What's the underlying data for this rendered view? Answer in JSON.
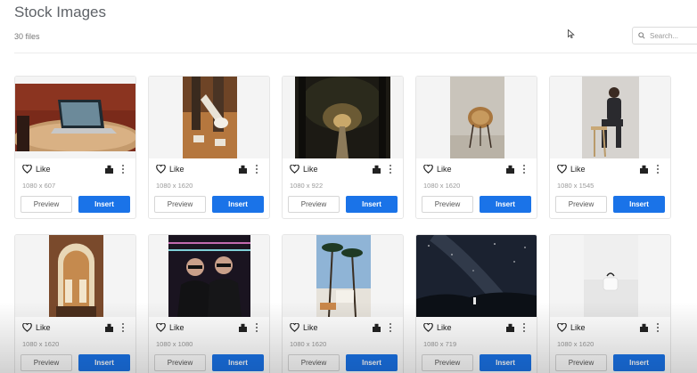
{
  "page": {
    "title": "Stock Images",
    "file_count": "30 files"
  },
  "search": {
    "placeholder": "Search..."
  },
  "colors": {
    "insert_button": "#1a73e8",
    "border": "#e6e6e6"
  },
  "cards": [
    {
      "dims": "1080 x 607",
      "like_label": "Like",
      "preview_label": "Preview",
      "insert_label": "Insert",
      "photo": "laptop on wooden table"
    },
    {
      "dims": "1080 x 1620",
      "like_label": "Like",
      "preview_label": "Preview",
      "insert_label": "Insert",
      "photo": "person with guitar"
    },
    {
      "dims": "1080 x 922",
      "like_label": "Like",
      "preview_label": "Preview",
      "insert_label": "Insert",
      "photo": "forest path"
    },
    {
      "dims": "1080 x 1620",
      "like_label": "Like",
      "preview_label": "Preview",
      "insert_label": "Insert",
      "photo": "rattan chair"
    },
    {
      "dims": "1080 x 1545",
      "like_label": "Like",
      "preview_label": "Preview",
      "insert_label": "Insert",
      "photo": "man sitting on stool"
    },
    {
      "dims": "1080 x 1620",
      "like_label": "Like",
      "preview_label": "Preview",
      "insert_label": "Insert",
      "photo": "arched doorway"
    },
    {
      "dims": "1080 x 1080",
      "like_label": "Like",
      "preview_label": "Preview",
      "insert_label": "Insert",
      "photo": "two men in sunglasses"
    },
    {
      "dims": "1080 x 1620",
      "like_label": "Like",
      "preview_label": "Preview",
      "insert_label": "Insert",
      "photo": "palm trees street"
    },
    {
      "dims": "1080 x 719",
      "like_label": "Like",
      "preview_label": "Preview",
      "insert_label": "Insert",
      "photo": "starry night sky"
    },
    {
      "dims": "1080 x 1620",
      "like_label": "Like",
      "preview_label": "Preview",
      "insert_label": "Insert",
      "photo": "white cup on white"
    }
  ]
}
